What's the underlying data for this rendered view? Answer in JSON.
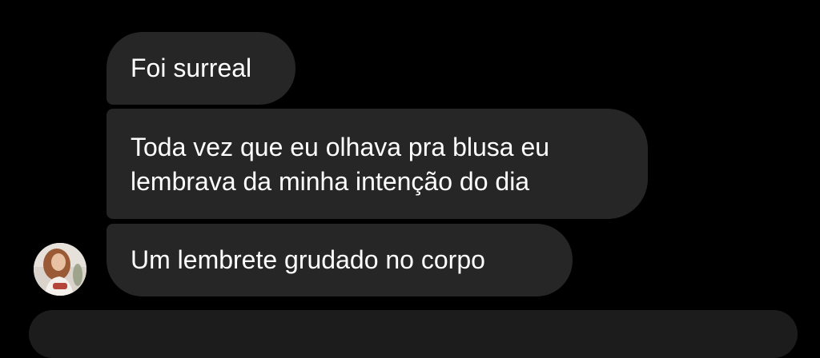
{
  "messages": [
    {
      "lines": [
        "Foi surreal"
      ]
    },
    {
      "lines": [
        "Toda vez que eu olhava pra blusa eu",
        "lembrava da minha intenção do dia"
      ]
    },
    {
      "lines": [
        "Um lembrete grudado no corpo"
      ]
    }
  ],
  "colors": {
    "background": "#000000",
    "bubble": "#262626",
    "text": "#ffffff"
  },
  "sender": {
    "avatar_icon": "profile-photo-avatar"
  }
}
